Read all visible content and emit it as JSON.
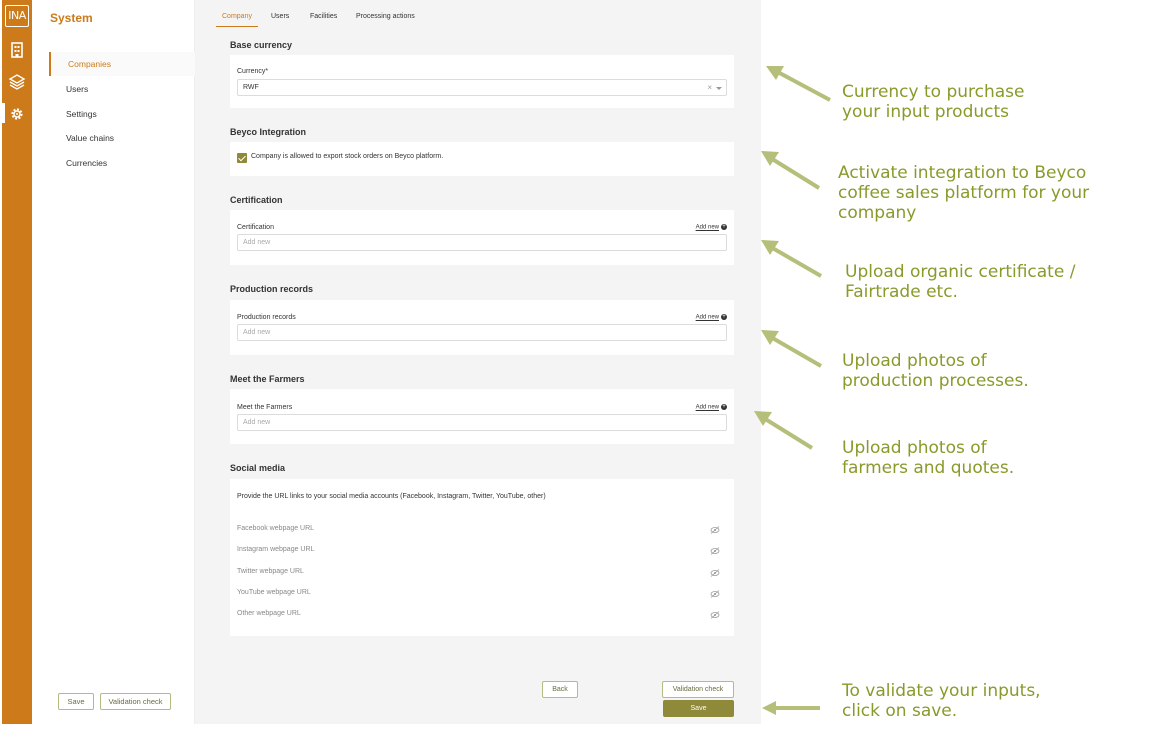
{
  "rail": {
    "logo": "INA",
    "icons": [
      "building-icon",
      "layers-icon",
      "gear-icon"
    ]
  },
  "sidebar": {
    "title": "System",
    "items": [
      {
        "label": "Companies"
      },
      {
        "label": "Users"
      },
      {
        "label": "Settings"
      },
      {
        "label": "Value chains"
      },
      {
        "label": "Currencies"
      }
    ],
    "save_label": "Save",
    "validation_label": "Validation check"
  },
  "tabs": [
    {
      "label": "Company"
    },
    {
      "label": "Users"
    },
    {
      "label": "Facilities"
    },
    {
      "label": "Processing actions"
    }
  ],
  "sections": {
    "base_currency": {
      "title": "Base currency",
      "field_label": "Currency*",
      "value": "RWF",
      "clear": "×"
    },
    "beyco": {
      "title": "Beyco Integration",
      "checkbox_label": "Company is allowed to export stock orders on Beyco platform.",
      "checked": true
    },
    "certification": {
      "title": "Certification",
      "field_label": "Certification",
      "add_new": "Add new",
      "placeholder": "Add new"
    },
    "production_records": {
      "title": "Production records",
      "field_label": "Production records",
      "add_new": "Add new",
      "placeholder": "Add new"
    },
    "meet_farmers": {
      "title": "Meet the Farmers",
      "field_label": "Meet the Farmers",
      "add_new": "Add new",
      "placeholder": "Add new"
    },
    "social_media": {
      "title": "Social media",
      "description": "Provide the URL links to your social media accounts (Facebook, Instagram, Twitter, YouTube, other)",
      "rows": [
        {
          "label": "Facebook webpage URL"
        },
        {
          "label": "Instagram webpage URL"
        },
        {
          "label": "Twitter webpage URL"
        },
        {
          "label": "YouTube webpage URL"
        },
        {
          "label": "Other webpage URL"
        }
      ]
    }
  },
  "footer": {
    "back_label": "Back",
    "validation_label": "Validation check",
    "save_label": "Save"
  },
  "annotations": [
    {
      "line1": "Currency to purchase",
      "line2": "your  input products"
    },
    {
      "line1": "Activate integration to Beyco",
      "line2": "coffee sales platform for your",
      "line3": "company"
    },
    {
      "line1": "Upload organic certificate /",
      "line2": "Fairtrade etc."
    },
    {
      "line1": "Upload photos of",
      "line2": "production processes."
    },
    {
      "line1": "Upload photos of",
      "line2": "farmers and quotes."
    },
    {
      "line1": "To validate your inputs,",
      "line2": "click on save."
    }
  ],
  "colors": {
    "brand": "#cc7a1a",
    "accent": "#8e8a3a",
    "annotation": "#8a9a2a",
    "arrow": "#b5bf7a"
  }
}
